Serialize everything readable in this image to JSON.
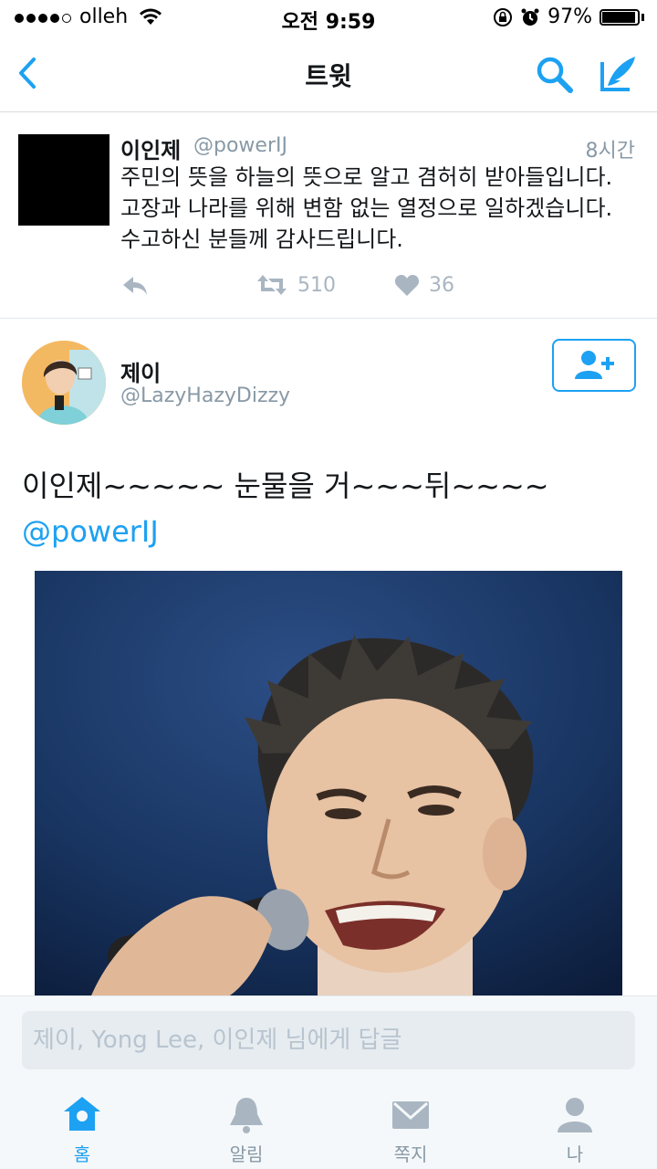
{
  "status_bar": {
    "carrier": "olleh",
    "time": "오전 9:59",
    "battery": "97%"
  },
  "nav": {
    "back_icon": "chevron-left-icon",
    "title": "트윗",
    "search_icon": "search-icon",
    "compose_icon": "compose-icon"
  },
  "tweet1": {
    "name": "이인제",
    "handle": "@powerIJ",
    "time_ago": "8시간",
    "body": "주민의 뜻을 하늘의 뜻으로 알고 겸허히 받아들입니다.\n고장과 나라를 위해 변함 없는 열정으로 일하겠습니다.\n수고하신 분들께 감사드립니다.",
    "retweets": "510",
    "likes": "36"
  },
  "tweet2": {
    "name": "제이",
    "handle": "@LazyHazyDizzy",
    "text": "이인제~~~~~ 눈물을 거~~~뒤~~~~",
    "mention": "@powerIJ"
  },
  "reply": {
    "placeholder": "제이, Yong Lee, 이인제 님에게 답글"
  },
  "tabs": [
    {
      "label": "홈",
      "icon": "home-icon"
    },
    {
      "label": "알림",
      "icon": "bell-icon"
    },
    {
      "label": "쪽지",
      "icon": "envelope-icon"
    },
    {
      "label": "나",
      "icon": "person-icon"
    }
  ],
  "colors": {
    "accent": "#1da1f2",
    "muted": "#8899a6"
  }
}
